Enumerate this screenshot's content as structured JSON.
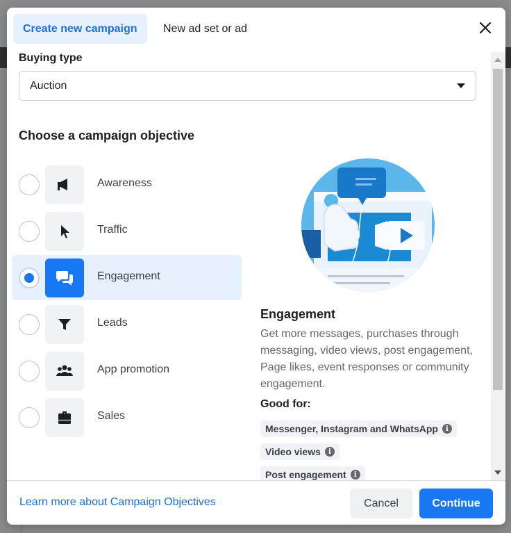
{
  "tabs": [
    {
      "label": "Create new campaign",
      "active": true
    },
    {
      "label": "New ad set or ad",
      "active": false
    }
  ],
  "buying_type": {
    "label": "Buying type",
    "value": "Auction"
  },
  "objective_section": {
    "title": "Choose a campaign objective",
    "items": [
      {
        "label": "Awareness",
        "icon": "megaphone-icon",
        "selected": false
      },
      {
        "label": "Traffic",
        "icon": "cursor-icon",
        "selected": false
      },
      {
        "label": "Engagement",
        "icon": "chat-bubbles-icon",
        "selected": true
      },
      {
        "label": "Leads",
        "icon": "funnel-icon",
        "selected": false
      },
      {
        "label": "App promotion",
        "icon": "people-icon",
        "selected": false
      },
      {
        "label": "Sales",
        "icon": "briefcase-icon",
        "selected": false
      }
    ]
  },
  "detail": {
    "title": "Engagement",
    "description": "Get more messages, purchases through messaging, video views, post engagement, Page likes, event responses or community engagement.",
    "good_for_label": "Good for:",
    "chips": [
      "Messenger, Instagram and WhatsApp",
      "Video views",
      "Post engagement"
    ]
  },
  "footer": {
    "learn_more": "Learn more about Campaign Objectives",
    "cancel": "Cancel",
    "continue": "Continue"
  },
  "colors": {
    "accent": "#1877f2",
    "selected_bg": "#e7f0fd"
  }
}
